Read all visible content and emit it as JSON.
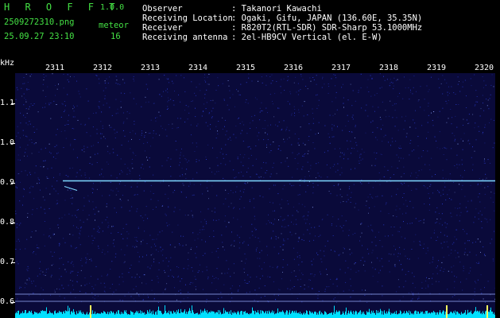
{
  "header": {
    "app_name": "H R O F F T",
    "version": "1.0.0",
    "filename": "2509272310.png",
    "datetime": "25.09.27 23:10",
    "count_label": "meteor",
    "count_value": "16",
    "fields": [
      {
        "label": "Observer",
        "value": ": Takanori Kawachi"
      },
      {
        "label": "Receiving Location",
        "value": ": Ogaki, Gifu, JAPAN (136.60E, 35.35N)"
      },
      {
        "label": "Receiver",
        "value": ": R820T2(RTL-SDR) SDR-Sharp 53.1000MHz"
      },
      {
        "label": "Receiving antenna",
        "value": ": 2el-HB9CV Vertical (el. E-W)"
      }
    ]
  },
  "axes": {
    "y_unit": "kHz",
    "x_ticks": [
      "2311",
      "2312",
      "2313",
      "2314",
      "2315",
      "2316",
      "2317",
      "2318",
      "2319",
      "2320"
    ],
    "y_ticks": [
      "1.1",
      "1.0",
      "0.9",
      "0.8",
      "0.7",
      "0.6"
    ]
  },
  "spectrogram": {
    "carrier_khz": 0.905,
    "colors": {
      "background": "#0a0a3a",
      "noise": "#2a3ccc",
      "carrier": "#7fd8ff",
      "baseline": "#00e0ff",
      "marker": "#ffff60"
    }
  }
}
